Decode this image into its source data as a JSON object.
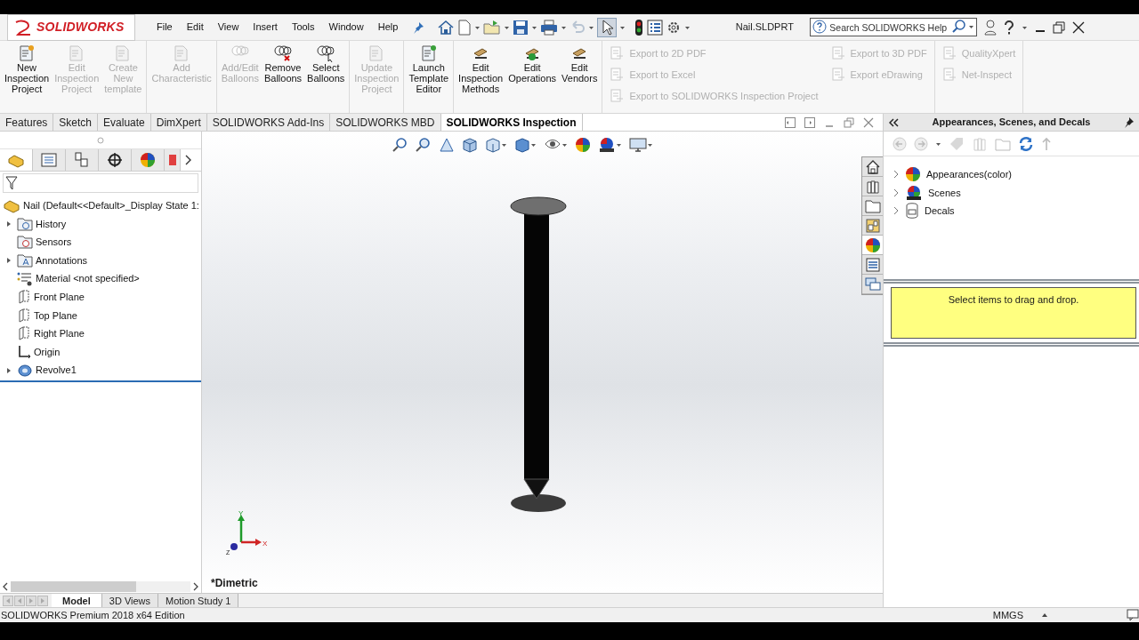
{
  "app": {
    "logo": "SOLIDWORKS",
    "menu": [
      "File",
      "Edit",
      "View",
      "Insert",
      "Tools",
      "Window",
      "Help"
    ],
    "filename": "Nail.SLDPRT",
    "search": {
      "placeholder": "Search SOLIDWORKS Help"
    }
  },
  "ribbon": {
    "groups": [
      [
        {
          "label": "New Inspection Project",
          "disabled": false
        },
        {
          "label": "Edit Inspection Project",
          "disabled": true
        },
        {
          "label": "Create New template",
          "disabled": true
        }
      ],
      [
        {
          "label": "Add Characteristic",
          "disabled": true
        }
      ],
      [
        {
          "label": "Add/Edit Balloons",
          "disabled": true
        },
        {
          "label": "Remove Balloons",
          "disabled": false
        },
        {
          "label": "Select Balloons",
          "disabled": false
        }
      ],
      [
        {
          "label": "Update Inspection Project",
          "disabled": true
        }
      ],
      [
        {
          "label": "Launch Template Editor",
          "disabled": false
        }
      ],
      [
        {
          "label": "Edit Inspection Methods",
          "disabled": false
        },
        {
          "label": "Edit Operations",
          "disabled": false
        },
        {
          "label": "Edit Vendors",
          "disabled": false
        }
      ]
    ],
    "export_groups": [
      [
        [
          {
            "label": "Export to 2D PDF",
            "disabled": true
          },
          {
            "label": "Export to Excel",
            "disabled": true
          },
          {
            "label": "Export to SOLIDWORKS Inspection Project",
            "disabled": true
          }
        ],
        [
          {
            "label": "Export to 3D PDF",
            "disabled": true
          },
          {
            "label": "Export eDrawing",
            "disabled": true
          }
        ]
      ],
      [
        [
          {
            "label": "QualityXpert",
            "disabled": true
          },
          {
            "label": "Net-Inspect",
            "disabled": true
          }
        ]
      ]
    ]
  },
  "command_tabs": [
    {
      "label": "Features",
      "selected": false
    },
    {
      "label": "Sketch",
      "selected": false
    },
    {
      "label": "Evaluate",
      "selected": false
    },
    {
      "label": "DimXpert",
      "selected": false
    },
    {
      "label": "SOLIDWORKS Add-Ins",
      "selected": false
    },
    {
      "label": "SOLIDWORKS MBD",
      "selected": false
    },
    {
      "label": "SOLIDWORKS Inspection",
      "selected": true
    }
  ],
  "feature_manager": {
    "panel_tabs": [
      {
        "selected": true
      },
      {
        "selected": false
      },
      {
        "selected": false
      },
      {
        "selected": false
      },
      {
        "selected": false
      },
      {
        "selected": false
      }
    ],
    "tree": {
      "label": "Nail  (Default<<Default>_Display State 1:",
      "kind": "part",
      "children": [
        {
          "label": "History",
          "kind": "history",
          "expanded": false
        },
        {
          "label": "Sensors",
          "kind": "sensors"
        },
        {
          "label": "Annotations",
          "kind": "annotations",
          "expanded": false
        },
        {
          "label": "Material <not specified>",
          "kind": "material"
        },
        {
          "label": "Front Plane",
          "kind": "plane"
        },
        {
          "label": "Top Plane",
          "kind": "plane"
        },
        {
          "label": "Right Plane",
          "kind": "plane"
        },
        {
          "label": "Origin",
          "kind": "origin"
        },
        {
          "label": "Revolve1",
          "kind": "feature",
          "expanded": false
        }
      ]
    }
  },
  "viewport": {
    "view_name": "*Dimetric",
    "axes": [
      "Y",
      "X",
      "Z"
    ]
  },
  "task_pane": {
    "title": "Appearances, Scenes, and Decals",
    "tabs": [
      {
        "selected": false
      },
      {
        "selected": false
      },
      {
        "selected": false
      },
      {
        "selected": false
      },
      {
        "selected": true
      },
      {
        "selected": false
      },
      {
        "selected": false
      }
    ],
    "items": [
      {
        "label": "Appearances(color)",
        "kind": "appearances",
        "expanded": false
      },
      {
        "label": "Scenes",
        "kind": "scenes",
        "expanded": false
      },
      {
        "label": "Decals",
        "kind": "decals",
        "expanded": false
      }
    ],
    "message": "Select items to drag and drop."
  },
  "bottom_tabs": [
    {
      "label": "Model",
      "selected": true
    },
    {
      "label": "3D Views",
      "selected": false
    },
    {
      "label": "Motion Study 1",
      "selected": false
    }
  ],
  "status_bar": {
    "text": "SOLIDWORKS Premium 2018 x64 Edition",
    "units": "MMGS"
  }
}
